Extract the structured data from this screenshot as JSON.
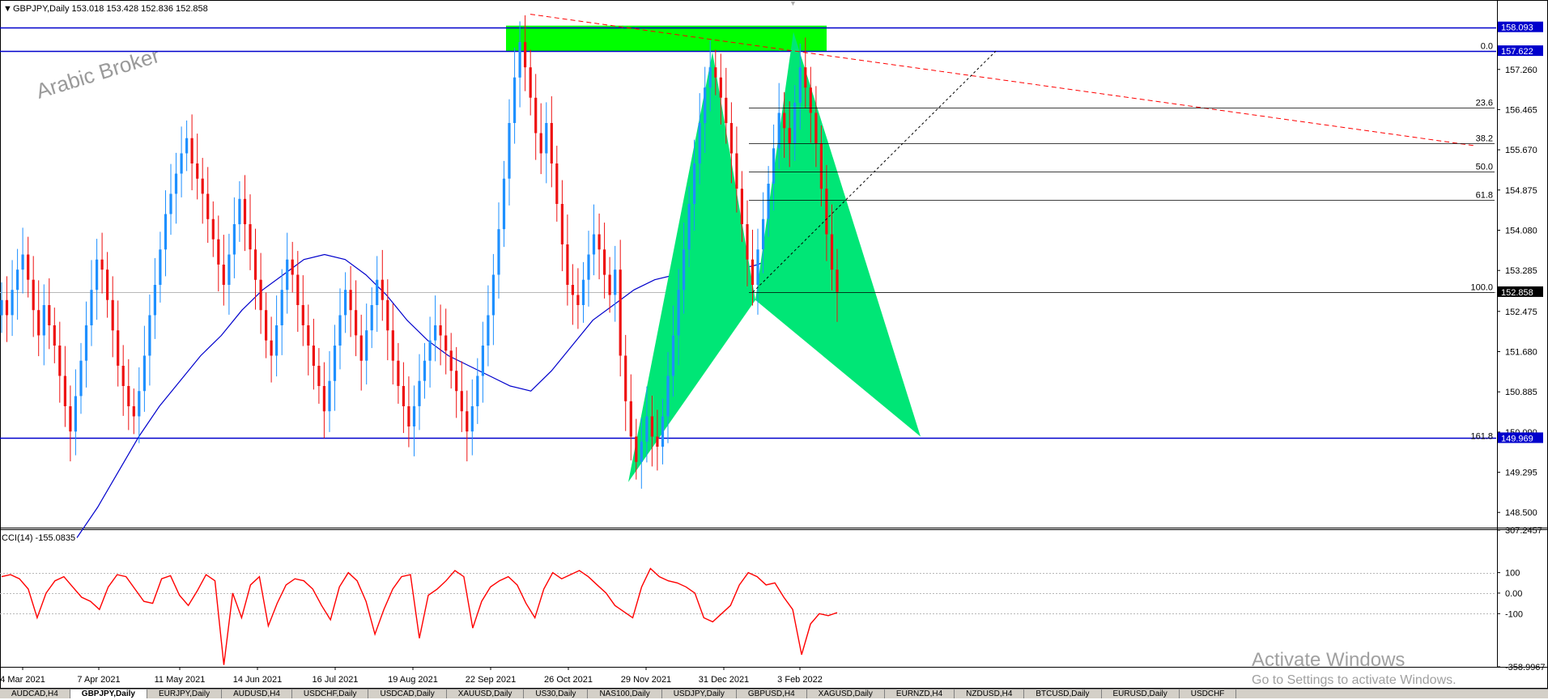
{
  "header": {
    "symbol": "GBPJPY,Daily",
    "ohlc": "153.018 153.428 152.836 152.858"
  },
  "watermark": "Arabic Broker",
  "activate": {
    "title": "Activate Windows",
    "subtitle": "Go to Settings to activate Windows."
  },
  "tabs": [
    "AUDCAD,H4",
    "GBPJPY,Daily",
    "EURJPY,Daily",
    "AUDUSD,H4",
    "USDCHF,Daily",
    "USDCAD,Daily",
    "XAUUSD,Daily",
    "US30,Daily",
    "NAS100,Daily",
    "USDJPY,Daily",
    "GBPUSD,H4",
    "XAGUSD,Daily",
    "EURNZD,H4",
    "NZDUSD,H4",
    "BTCUSD,Daily",
    "EURUSD,Daily",
    "USDCHF"
  ],
  "active_tab": 1,
  "chart_data": [
    {
      "type": "candlestick",
      "symbol": "GBPJPY",
      "timeframe": "Daily",
      "x_tick_labels": [
        "4 Mar 2021",
        "7 Apr 2021",
        "11 May 2021",
        "14 Jun 2021",
        "16 Jul 2021",
        "19 Aug 2021",
        "22 Sep 2021",
        "26 Oct 2021",
        "29 Nov 2021",
        "31 Dec 2021",
        "3 Feb 2022"
      ],
      "y_tick_labels": [
        "157.260",
        "156.465",
        "155.670",
        "154.875",
        "154.080",
        "153.285",
        "152.475",
        "151.680",
        "150.885",
        "150.090",
        "149.295",
        "148.500"
      ],
      "ylim": [
        148.2,
        158.6
      ],
      "price_boxes": [
        {
          "label": "158.093",
          "value": 158.093,
          "color": "#0000cc"
        },
        {
          "label": "157.622",
          "value": 157.622,
          "color": "#0000cc"
        },
        {
          "label": "152.858",
          "value": 152.858,
          "color": "#000000"
        },
        {
          "label": "149.969",
          "value": 149.969,
          "color": "#0000cc"
        }
      ],
      "horizontal_lines": [
        {
          "value": 158.093,
          "color": "#0000cc"
        },
        {
          "value": 157.622,
          "color": "#0000cc"
        },
        {
          "value": 149.969,
          "color": "#0000cc"
        }
      ],
      "fibonacci": {
        "color": "#000000",
        "levels": [
          {
            "label": "0.0",
            "value": 157.622
          },
          {
            "label": "23.6",
            "value": 156.498
          },
          {
            "label": "38.2",
            "value": 155.802
          },
          {
            "label": "50.0",
            "value": 155.24
          },
          {
            "label": "61.8",
            "value": 154.678
          },
          {
            "label": "100.0",
            "value": 152.858
          },
          {
            "label": "161.8",
            "value": 149.914
          }
        ]
      },
      "price_series": [
        152.7,
        152.4,
        152.9,
        153.3,
        153.6,
        153.1,
        152.5,
        152.0,
        152.6,
        152.2,
        151.8,
        151.2,
        150.6,
        150.1,
        150.8,
        151.5,
        152.2,
        152.9,
        153.5,
        153.3,
        152.7,
        152.1,
        151.4,
        151.0,
        150.6,
        150.4,
        150.9,
        151.6,
        152.4,
        153.0,
        153.7,
        154.4,
        154.8,
        155.2,
        155.6,
        155.9,
        155.4,
        155.1,
        154.8,
        154.3,
        153.9,
        153.4,
        153.0,
        153.6,
        154.2,
        154.7,
        154.2,
        153.7,
        153.1,
        152.5,
        151.9,
        151.6,
        152.2,
        152.9,
        153.5,
        153.2,
        152.6,
        152.2,
        151.8,
        151.4,
        151.0,
        150.5,
        151.1,
        151.8,
        152.4,
        152.9,
        152.5,
        152.0,
        151.5,
        152.1,
        152.6,
        153.1,
        152.7,
        152.1,
        151.5,
        151.0,
        150.6,
        150.2,
        150.6,
        151.1,
        151.5,
        151.9,
        152.2,
        152.0,
        151.7,
        151.3,
        150.9,
        150.5,
        150.1,
        150.6,
        151.2,
        151.8,
        152.4,
        153.2,
        154.1,
        155.1,
        156.2,
        157.1,
        157.8,
        157.3,
        156.7,
        156.0,
        155.6,
        156.2,
        155.4,
        154.6,
        153.8,
        153.0,
        152.8,
        152.6,
        153.1,
        153.6,
        154.0,
        153.7,
        153.2,
        152.8,
        153.3,
        151.6,
        150.7,
        150.0,
        149.5,
        149.9,
        150.4,
        150.0,
        149.8,
        150.4,
        151.2,
        152.0,
        152.9,
        153.7,
        154.6,
        155.4,
        156.2,
        156.9,
        157.3,
        157.1,
        156.7,
        156.2,
        155.6,
        154.9,
        154.2,
        153.5,
        153.0,
        153.7,
        154.3,
        155.0,
        155.7,
        156.4,
        156.1,
        155.8,
        156.6,
        157.3,
        156.9,
        156.4,
        155.8,
        154.9,
        154.0,
        153.3,
        152.858
      ],
      "moving_average": {
        "color": "#0000cc",
        "values": [
          148.0,
          148.6,
          149.3,
          150.0,
          150.6,
          151.1,
          151.6,
          152.0,
          152.5,
          152.9,
          153.2,
          153.5,
          153.6,
          153.5,
          153.2,
          152.8,
          152.3,
          151.9,
          151.6,
          151.4,
          151.2,
          151.0,
          150.9,
          151.3,
          151.8,
          152.3,
          152.6,
          152.9,
          153.1,
          153.2,
          153.3,
          153.3,
          153.3,
          153.4,
          153.6,
          153.9,
          154.4,
          155.0
        ]
      },
      "harmonic_pattern": {
        "color": "#00e676",
        "points": [
          {
            "point": "X",
            "value": 149.1
          },
          {
            "point": "A",
            "value": 157.6
          },
          {
            "point": "B",
            "value": 152.7
          },
          {
            "point": "C",
            "value": 158.0
          },
          {
            "point": "D",
            "value": 150.0
          }
        ]
      },
      "resistance_zone": {
        "from": 157.622,
        "to": 158.093,
        "color": "#00ff00"
      },
      "trendlines": [
        {
          "style": "dashed",
          "color": "#ff0000",
          "from": 158.35,
          "to": 155.75
        },
        {
          "style": "dotted",
          "color": "#000000",
          "from": 152.858,
          "to": 157.622
        }
      ]
    },
    {
      "type": "line",
      "name": "CCI(14)",
      "header": "CCI(14) -155.0835",
      "color": "#ff0000",
      "y_tick_labels": [
        "307.2457",
        "100",
        "0.00",
        "-100",
        "-358.9967"
      ],
      "ylim": [
        -358.9967,
        307.2457
      ],
      "levels": [
        100,
        0,
        -100
      ],
      "values": [
        80,
        90,
        70,
        20,
        -120,
        0,
        60,
        80,
        30,
        -20,
        -40,
        -80,
        30,
        90,
        80,
        20,
        -40,
        -50,
        70,
        85,
        -10,
        -60,
        10,
        90,
        60,
        -350,
        0,
        -120,
        40,
        80,
        -160,
        -50,
        40,
        70,
        60,
        20,
        -60,
        -130,
        30,
        100,
        60,
        -40,
        -200,
        -80,
        20,
        80,
        90,
        -220,
        -10,
        20,
        60,
        110,
        80,
        -170,
        -40,
        30,
        60,
        80,
        40,
        -50,
        -120,
        20,
        100,
        70,
        90,
        110,
        80,
        40,
        0,
        -60,
        -90,
        -120,
        30,
        120,
        80,
        60,
        50,
        30,
        0,
        -120,
        -140,
        -100,
        -60,
        40,
        100,
        80,
        40,
        50,
        -20,
        -80,
        -300,
        -150,
        -100,
        -110,
        -95
      ]
    }
  ]
}
